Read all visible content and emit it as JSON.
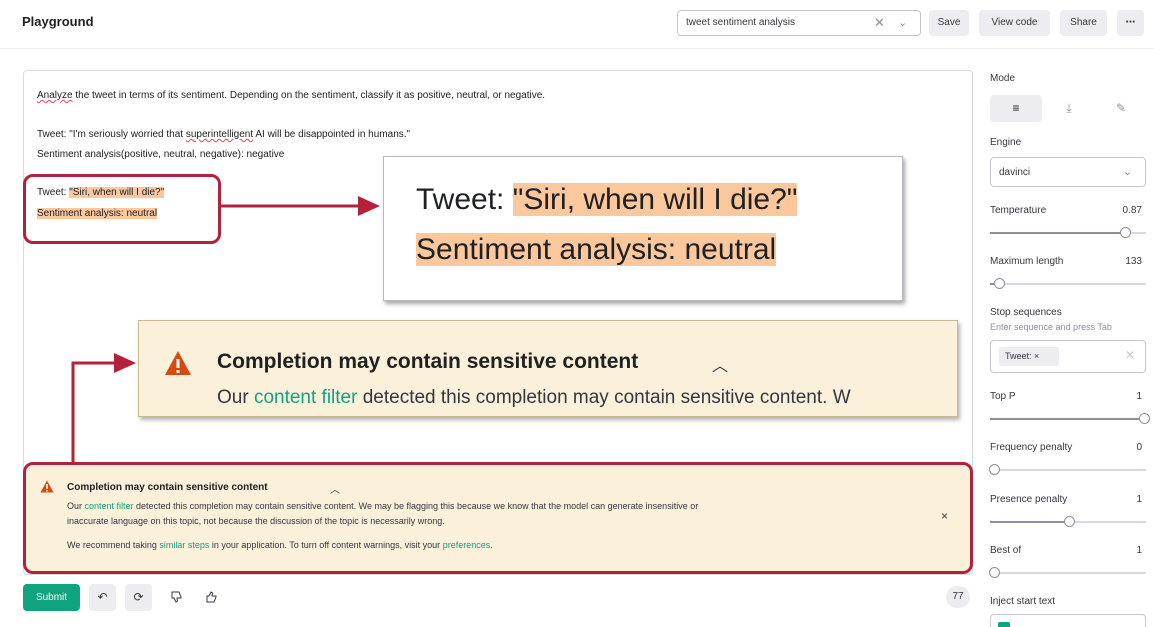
{
  "header": {
    "title": "Playground",
    "preset_value": "tweet sentiment analysis",
    "save_label": "Save",
    "view_code_label": "View code",
    "share_label": "Share",
    "more_label": "⋯"
  },
  "prompt": {
    "instruction_lead": "Analyze",
    "instruction_rest": " the tweet in terms of its sentiment. Depending on the sentiment, classify it as positive, neutral, or negative.",
    "example_tweet_prefix": "Tweet: \"I'm seriously worried that ",
    "example_tweet_squiggle": "superintelligent",
    "example_tweet_suffix": " AI will be disappointed in humans.\"",
    "example_analysis": "Sentiment analysis(positive, neutral, negative): negative",
    "query_tweet_prefix": "Tweet: ",
    "query_tweet_highlight": "\"Siri, when will I die?\"",
    "query_analysis": "Sentiment analysis: neutral"
  },
  "zoom": {
    "tweet_prefix": "Tweet: ",
    "tweet_highlight": "\"Siri, when will I die?\"",
    "analysis": "Sentiment analysis: neutral"
  },
  "warning_zoom": {
    "title": "Completion may contain sensitive content",
    "desc_prefix": "Our ",
    "desc_link": "content filter",
    "desc_suffix": " detected this completion may contain sensitive content. W"
  },
  "warning": {
    "title": "Completion may contain sensitive content",
    "line1_prefix": "Our ",
    "line1_link": "content filter",
    "line1_suffix": " detected this completion may contain sensitive content. We may be flagging this because we know that the model can generate insensitive or",
    "line2": "inaccurate language on this topic, not because the discussion of the topic is necessarily wrong.",
    "line3_prefix": "We recommend taking ",
    "line3_link1": "similar steps",
    "line3_mid": " in your application. To turn off content warnings, visit your ",
    "line3_link2": "preferences",
    "line3_suffix": ".",
    "close": "×"
  },
  "toolbar": {
    "submit_label": "Submit",
    "token_count": "77"
  },
  "settings": {
    "mode_label": "Mode",
    "engine_label": "Engine",
    "engine_value": "davinci",
    "temperature_label": "Temperature",
    "temperature_value": "0.87",
    "temperature_fraction": 0.87,
    "max_length_label": "Maximum length",
    "max_length_value": "133",
    "max_length_fraction": 0.03,
    "stop_label": "Stop sequences",
    "stop_hint": "Enter sequence and press Tab",
    "stop_chip": "Tweet:",
    "top_p_label": "Top P",
    "top_p_value": "1",
    "top_p_fraction": 1.0,
    "freq_label": "Frequency penalty",
    "freq_value": "0",
    "freq_fraction": 0.0,
    "presence_label": "Presence penalty",
    "presence_value": "1",
    "presence_fraction": 0.5,
    "best_of_label": "Best of",
    "best_of_value": "1",
    "best_of_fraction": 0.0,
    "inject_label": "Inject start text"
  },
  "colors": {
    "accent": "#10a37f",
    "annotation_red": "#b4213a",
    "highlight": "#fbc79d",
    "warning_bg": "#fbf0d9",
    "warning_icon": "#d9480f"
  },
  "icons": [
    "warning-triangle-icon",
    "chevron-up-icon",
    "close-icon",
    "undo-icon",
    "regenerate-icon",
    "thumbs-down-icon",
    "thumbs-up-icon",
    "chevron-down-icon",
    "mode-complete-icon",
    "mode-insert-icon",
    "mode-edit-icon"
  ]
}
